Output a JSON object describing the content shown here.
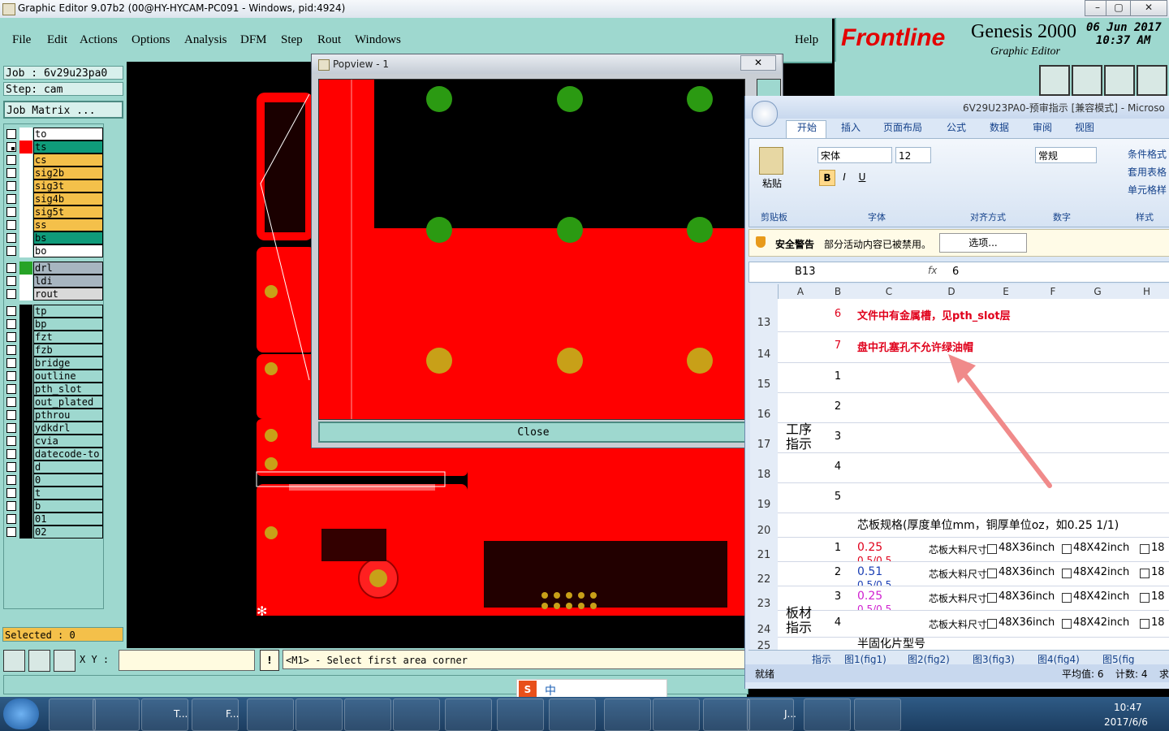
{
  "window": {
    "title": "Graphic Editor 9.07b2 (00@HY-HYCAM-PC091 - Windows, pid:4924)"
  },
  "menu": [
    "File",
    "Edit",
    "Actions",
    "Options",
    "Analysis",
    "DFM",
    "Step",
    "Rout",
    "Windows"
  ],
  "help": "Help",
  "brand": {
    "logo": "Frontline",
    "product": "Genesis 2000",
    "subtitle": "Graphic Editor",
    "date": "06 Jun 2017",
    "time": "10:37 AM"
  },
  "job": {
    "job_line": "Job : 6v29u23pa0",
    "step_line": "Step: cam",
    "matrix_button": "Job Matrix ..."
  },
  "layers_group1": [
    {
      "name": "to",
      "color": "#ffffff",
      "fill": "#ffffff"
    },
    {
      "name": "ts",
      "color": "#ff0000",
      "fill": "#0f9b7a",
      "selected": true
    },
    {
      "name": "cs",
      "color": "#ffffff",
      "fill": "#f4c04a"
    },
    {
      "name": "sig2b",
      "color": "#ffffff",
      "fill": "#f4c04a"
    },
    {
      "name": "sig3t",
      "color": "#ffffff",
      "fill": "#f4c04a"
    },
    {
      "name": "sig4b",
      "color": "#ffffff",
      "fill": "#f4c04a"
    },
    {
      "name": "sig5t",
      "color": "#ffffff",
      "fill": "#f4c04a"
    },
    {
      "name": "ss",
      "color": "#ffffff",
      "fill": "#f4c04a"
    },
    {
      "name": "bs",
      "color": "#ffffff",
      "fill": "#0f9b7a"
    },
    {
      "name": "bo",
      "color": "#ffffff",
      "fill": "#ffffff"
    }
  ],
  "layers_group2": [
    {
      "name": "drl",
      "color": "#27a327",
      "fill": "#a7b5c0"
    },
    {
      "name": "ldi",
      "color": "#ffffff",
      "fill": "#a7b5c0"
    },
    {
      "name": "rout",
      "color": "#ffffff",
      "fill": "#d9d9d9"
    }
  ],
  "layers_group3": [
    {
      "name": "tp"
    },
    {
      "name": "bp"
    },
    {
      "name": "fzt"
    },
    {
      "name": "fzb"
    },
    {
      "name": "bridge"
    },
    {
      "name": "outline"
    },
    {
      "name": "pth_slot"
    },
    {
      "name": "out_plated"
    },
    {
      "name": "pthrou"
    },
    {
      "name": "ydkdrl"
    },
    {
      "name": "cvia"
    },
    {
      "name": "datecode-to"
    },
    {
      "name": "d"
    },
    {
      "name": "0"
    },
    {
      "name": "t"
    },
    {
      "name": "b"
    },
    {
      "name": "01"
    },
    {
      "name": "02"
    }
  ],
  "selected_count": "Selected : 0",
  "xy_label": "X Y :",
  "xy_value": "",
  "prompt": "<M1> - Select first area corner",
  "popview": {
    "title": "Popview - 1",
    "close_button": "Close"
  },
  "excel": {
    "title": "6V29U23PA0-预审指示 [兼容模式] - Microso",
    "tabs": [
      "开始",
      "插入",
      "页面布局",
      "公式",
      "数据",
      "审阅",
      "视图"
    ],
    "paste": "粘贴",
    "font_name": "宋体",
    "font_size": "12",
    "number_format": "常规",
    "styles": [
      "条件格式",
      "套用表格",
      "单元格样"
    ],
    "groups": [
      "剪贴板",
      "字体",
      "对齐方式",
      "数字",
      "样式"
    ],
    "security_label": "安全警告",
    "security_text": "部分活动内容已被禁用。",
    "options_button": "选项...",
    "name_box": "B13",
    "fx": "fx",
    "formula": "6",
    "columns": [
      "A",
      "B",
      "C",
      "D",
      "E",
      "F",
      "G",
      "H"
    ],
    "rows": [
      {
        "num": "13",
        "b": "6",
        "c": "文件中有金属槽，见pth_slot层",
        "red": true
      },
      {
        "num": "14",
        "b": "7",
        "c": "盘中孔塞孔不允许绿油帽",
        "red": true
      },
      {
        "num": "15",
        "b": "1",
        "c": ""
      },
      {
        "num": "16",
        "b": "2",
        "c": ""
      },
      {
        "num": "17",
        "b": "3",
        "c": ""
      },
      {
        "num": "18",
        "b": "4",
        "c": ""
      },
      {
        "num": "19",
        "b": "5",
        "c": ""
      },
      {
        "num": "20",
        "b": "",
        "c": "芯板规格(厚度单位mm，铜厚单位oz，如0.25 1/1)"
      },
      {
        "num": "21",
        "b": "1",
        "c": "0.25"
      },
      {
        "num": "22",
        "b": "2",
        "c": "0.51"
      },
      {
        "num": "23",
        "b": "3",
        "c": "0.25"
      },
      {
        "num": "24",
        "b": "4",
        "c": ""
      },
      {
        "num": "25",
        "b": "",
        "c": "半固化片型号"
      }
    ],
    "merged_a_1": "工序指示",
    "merged_a_2": "板材指示",
    "core_label": "芯板大料尺寸:",
    "opt1": "48X36inch",
    "opt2": "48X42inch",
    "opt3": "18",
    "sub_values": [
      "0.5/0.5",
      "0.5/0.5",
      "0.5/0.5"
    ],
    "sheet_tabs": [
      "指示",
      "图1(fig1)",
      "图2(fig2)",
      "图3(fig3)",
      "图4(fig4)",
      "图5(fig"
    ],
    "status_ready": "就绪",
    "status_avg": "平均值: 6",
    "status_count": "计数: 4",
    "status_sum": "求"
  },
  "ime": {
    "label": "中"
  },
  "taskbar": {
    "items": [
      "T...",
      "F...",
      "J..."
    ],
    "time": "10:47",
    "date": "2017/6/6"
  },
  "colors": {
    "panel": "#9ed8cf",
    "pcb_copper": "#ff0000",
    "drill_green": "#2b9a12",
    "pad_gold": "#c8a018",
    "excel_red": "#e0001b"
  }
}
